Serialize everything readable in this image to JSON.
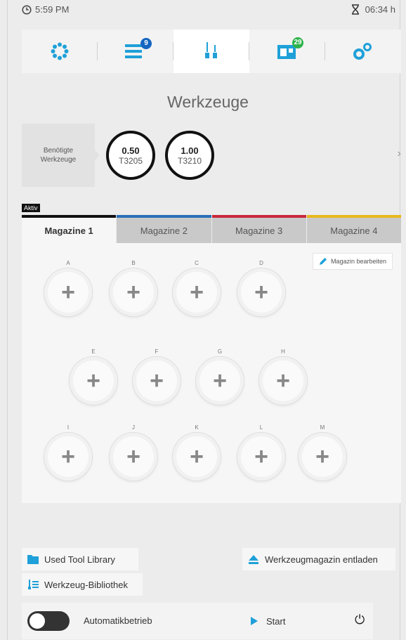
{
  "status": {
    "time": "5:59 PM",
    "remaining": "06:34 h"
  },
  "nav": {
    "items": [
      {
        "icon": "dots-ring-icon",
        "badge": ""
      },
      {
        "icon": "job-list-icon",
        "badge": "9"
      },
      {
        "icon": "tools-icon",
        "badge": ""
      },
      {
        "icon": "magazine-icon",
        "badge": "29"
      },
      {
        "icon": "gears-icon",
        "badge": ""
      }
    ],
    "active_index": 2
  },
  "page": {
    "title": "Werkzeuge"
  },
  "needed": {
    "label_line1": "Benötigte",
    "label_line2": "Werkzeuge",
    "tools": [
      {
        "value": "0.50",
        "name": "T3205"
      },
      {
        "value": "1.00",
        "name": "T3210"
      }
    ],
    "next_glyph": "›"
  },
  "magazines": {
    "active_label": "Aktiv",
    "tabs": [
      {
        "label": "Magazine 1",
        "color": "#111111"
      },
      {
        "label": "Magazine 2",
        "color": "#2a6fb8"
      },
      {
        "label": "Magazine 3",
        "color": "#c8283a"
      },
      {
        "label": "Magazine 4",
        "color": "#e8b91c"
      }
    ],
    "edit_label": "Magazin bearbeiten",
    "slot_glyph": "+",
    "slots": [
      "A",
      "B",
      "C",
      "D",
      "E",
      "F",
      "G",
      "H",
      "I",
      "J",
      "K",
      "L",
      "M"
    ]
  },
  "actions": {
    "used_tool_library": "Used Tool Library",
    "tool_library": "Werkzeug-Bibliothek",
    "unload_magazine": "Werkzeugmagazin entladen"
  },
  "footer": {
    "auto_label": "Automatikbetrieb",
    "start_label": "Start",
    "power_glyph": "⏻"
  },
  "colors": {
    "accent": "#1fa0d8",
    "badge_blue": "#1565c0",
    "badge_green": "#2db34a"
  }
}
